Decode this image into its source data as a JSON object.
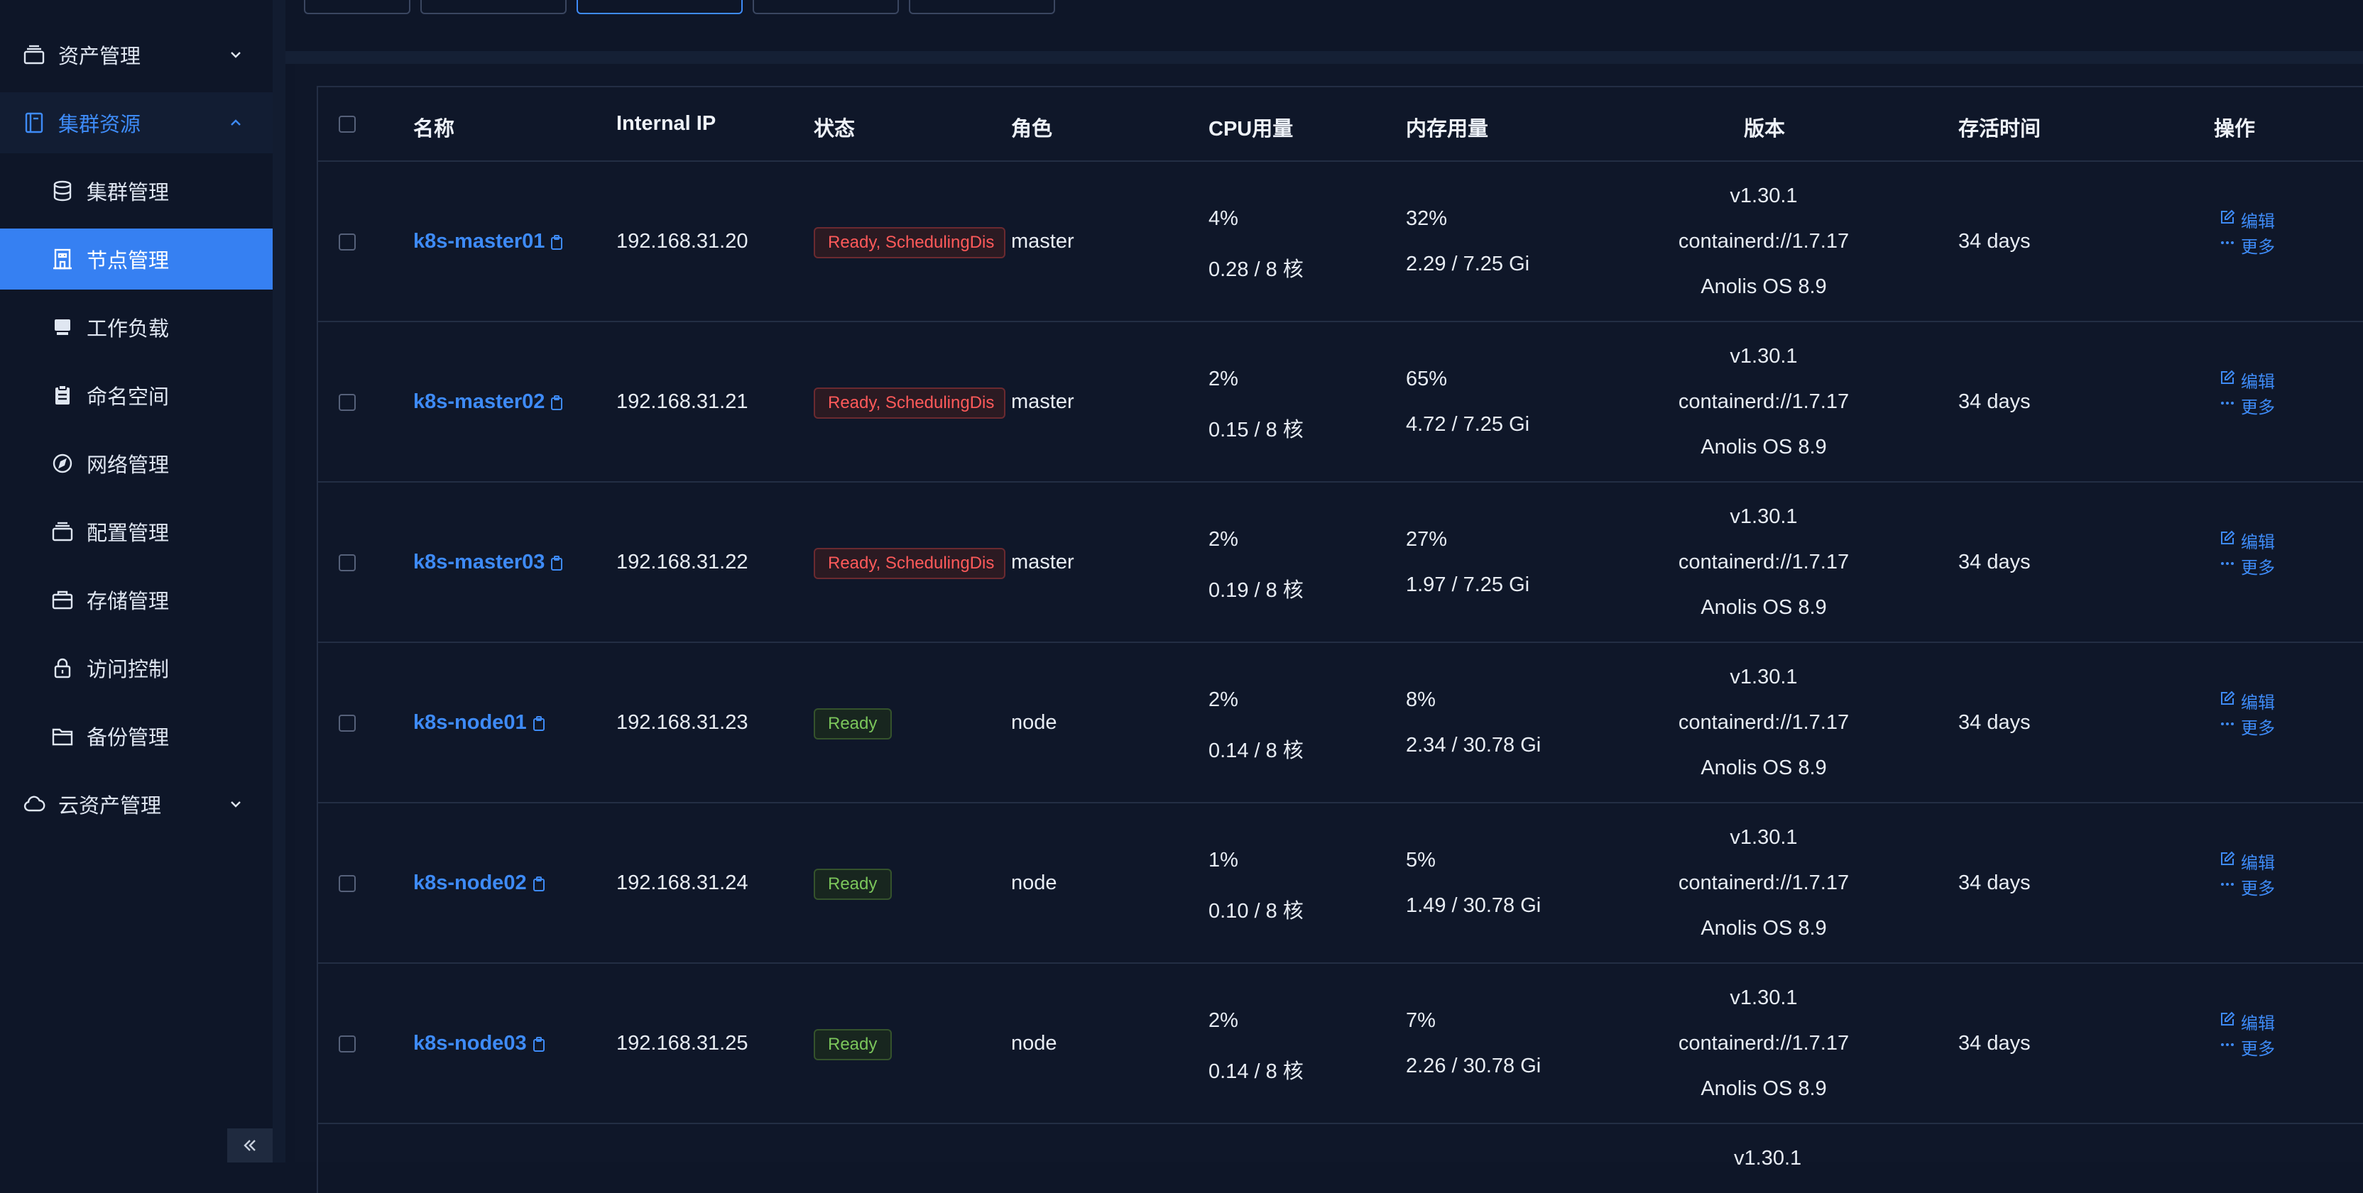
{
  "sidebar": {
    "items": [
      {
        "label": "资产管理",
        "icon": "stack-icon",
        "type": "group",
        "expanded": false
      },
      {
        "label": "集群资源",
        "icon": "book-icon",
        "type": "group",
        "expanded": true
      },
      {
        "label": "集群管理",
        "icon": "database-icon",
        "type": "sub"
      },
      {
        "label": "节点管理",
        "icon": "building-icon",
        "type": "sub",
        "active": true
      },
      {
        "label": "工作负载",
        "icon": "server-icon",
        "type": "sub"
      },
      {
        "label": "命名空间",
        "icon": "clipboard-icon",
        "type": "sub"
      },
      {
        "label": "网络管理",
        "icon": "compass-icon",
        "type": "sub"
      },
      {
        "label": "配置管理",
        "icon": "stack-icon",
        "type": "sub"
      },
      {
        "label": "存储管理",
        "icon": "storage-icon",
        "type": "sub"
      },
      {
        "label": "访问控制",
        "icon": "lock-icon",
        "type": "sub"
      },
      {
        "label": "备份管理",
        "icon": "folder-icon",
        "type": "sub"
      },
      {
        "label": "云资产管理",
        "icon": "cloud-icon",
        "type": "group",
        "expanded": false
      }
    ],
    "collapse_icon": "double-chevron-left-icon"
  },
  "table": {
    "headers": {
      "name": "名称",
      "ip": "Internal IP",
      "status": "状态",
      "role": "角色",
      "cpu": "CPU用量",
      "mem": "内存用量",
      "version": "版本",
      "age": "存活时间",
      "ops": "操作"
    },
    "rows": [
      {
        "name": "k8s-master01",
        "ip": "192.168.31.20",
        "status": "Ready, SchedulingDis",
        "status_type": "warning",
        "role": "master",
        "cpu_pct": "4%",
        "cpu_detail": "0.28 / 8 核",
        "mem_pct": "32%",
        "mem_detail": "2.29 / 7.25 Gi",
        "version": "v1.30.1",
        "runtime": "containerd://1.7.17",
        "os": "Anolis OS 8.9",
        "age": "34 days",
        "edit": "编辑",
        "more": "更多"
      },
      {
        "name": "k8s-master02",
        "ip": "192.168.31.21",
        "status": "Ready, SchedulingDis",
        "status_type": "warning",
        "role": "master",
        "cpu_pct": "2%",
        "cpu_detail": "0.15 / 8 核",
        "mem_pct": "65%",
        "mem_detail": "4.72 / 7.25 Gi",
        "version": "v1.30.1",
        "runtime": "containerd://1.7.17",
        "os": "Anolis OS 8.9",
        "age": "34 days",
        "edit": "编辑",
        "more": "更多"
      },
      {
        "name": "k8s-master03",
        "ip": "192.168.31.22",
        "status": "Ready, SchedulingDis",
        "status_type": "warning",
        "role": "master",
        "cpu_pct": "2%",
        "cpu_detail": "0.19 / 8 核",
        "mem_pct": "27%",
        "mem_detail": "1.97 / 7.25 Gi",
        "version": "v1.30.1",
        "runtime": "containerd://1.7.17",
        "os": "Anolis OS 8.9",
        "age": "34 days",
        "edit": "编辑",
        "more": "更多"
      },
      {
        "name": "k8s-node01",
        "ip": "192.168.31.23",
        "status": "Ready",
        "status_type": "ok",
        "role": "node",
        "cpu_pct": "2%",
        "cpu_detail": "0.14 / 8 核",
        "mem_pct": "8%",
        "mem_detail": "2.34 / 30.78 Gi",
        "version": "v1.30.1",
        "runtime": "containerd://1.7.17",
        "os": "Anolis OS 8.9",
        "age": "34 days",
        "edit": "编辑",
        "more": "更多"
      },
      {
        "name": "k8s-node02",
        "ip": "192.168.31.24",
        "status": "Ready",
        "status_type": "ok",
        "role": "node",
        "cpu_pct": "1%",
        "cpu_detail": "0.10 / 8 核",
        "mem_pct": "5%",
        "mem_detail": "1.49 / 30.78 Gi",
        "version": "v1.30.1",
        "runtime": "containerd://1.7.17",
        "os": "Anolis OS 8.9",
        "age": "34 days",
        "edit": "编辑",
        "more": "更多"
      },
      {
        "name": "k8s-node03",
        "ip": "192.168.31.25",
        "status": "Ready",
        "status_type": "ok",
        "role": "node",
        "cpu_pct": "2%",
        "cpu_detail": "0.14 / 8 核",
        "mem_pct": "7%",
        "mem_detail": "2.26 / 30.78 Gi",
        "version": "v1.30.1",
        "runtime": "containerd://1.7.17",
        "os": "Anolis OS 8.9",
        "age": "34 days",
        "edit": "编辑",
        "more": "更多"
      }
    ],
    "partial_row": {
      "version": "v1.30.1"
    }
  },
  "colors": {
    "accent": "#3e8bf7",
    "active_menu": "#3680f2",
    "background": "#0e1628",
    "warning_text": "#ff5a5a",
    "ok_text": "#7bc55b"
  }
}
